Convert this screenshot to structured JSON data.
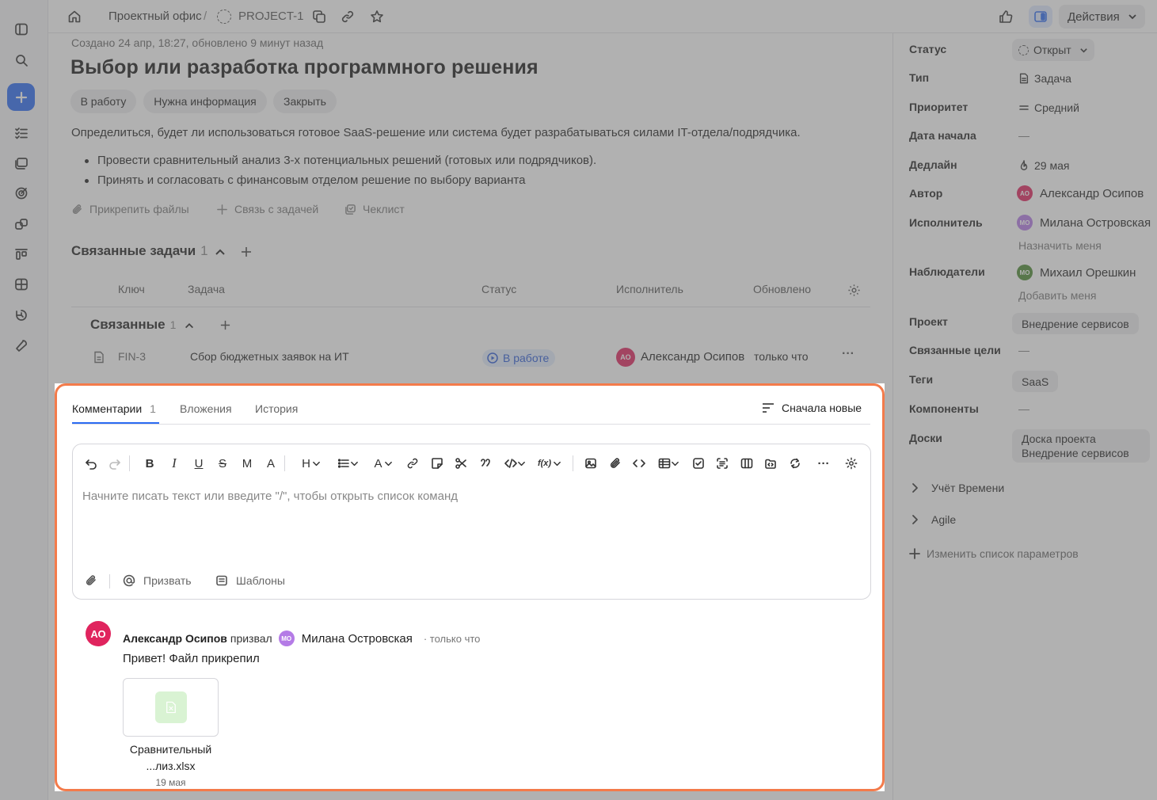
{
  "header": {
    "home_icon": "home-icon",
    "breadcrumb_1": "Проектный офис",
    "separator": "/",
    "breadcrumb_2": "PROJECT-1",
    "actions_label": "Действия"
  },
  "rail": {
    "items": [
      "panel-toggle-icon",
      "search-icon",
      "plus-icon",
      "tasks-icon",
      "stack-icon",
      "target-icon",
      "shapes-icon",
      "board-icon",
      "grid-icon",
      "history-icon",
      "wrench-icon"
    ]
  },
  "issue": {
    "meta": "Создано 24 апр, 18:27, обновлено 9 минут назад",
    "title": "Выбор или разработка программного решения",
    "actions": [
      "В работу",
      "Нужна информация",
      "Закрыть"
    ],
    "description": "Определиться, будет ли использоваться готовое SaaS-решение или система будет разрабатываться силами IT-отдела/подрядчика.",
    "bullets": [
      "Провести сравнительный анализ 3-х потенциальных решений (готовых или подрядчиков).",
      "Принять и согласовать с финансовым отделом решение по выбору варианта"
    ],
    "attach_files": "Прикрепить файлы",
    "link_task": "Связь с задачей",
    "checklist": "Чеклист"
  },
  "related": {
    "title": "Связанные задачи",
    "count": "1",
    "columns": [
      "Ключ",
      "Задача",
      "Статус",
      "Исполнитель",
      "Обновлено"
    ],
    "group_title": "Связанные",
    "group_count": "1",
    "row": {
      "key": "FIN-3",
      "task": "Сбор бюджетных заявок на ИТ",
      "status": "В работе",
      "assignee_initials": "АО",
      "assignee": "Александр Осипов",
      "updated": "только что",
      "more": "···"
    }
  },
  "comments": {
    "tabs": [
      "Комментарии",
      "Вложения",
      "История"
    ],
    "comments_count": "1",
    "sort_label": "Сначала новые",
    "placeholder": "Начните писать текст или введите \"/\", чтобы открыть список команд",
    "mention_label": "Призвать",
    "templates_label": "Шаблоны",
    "toolbar_text": {
      "bold": "B",
      "italic": "I",
      "underline": "U",
      "strike": "S",
      "mono": "M",
      "size": "A",
      "heading": "H",
      "color": "A",
      "formula": "f(x)",
      "more": "···"
    },
    "item": {
      "author_initials": "АО",
      "author": "Александр Осипов",
      "action": "призвал",
      "mention_initials": "МО",
      "mention": "Милана Островская",
      "time": "· только что",
      "text": "Привет! Файл прикрепил",
      "file_line1": "Сравнительный",
      "file_line2": "...лиз.xlsx",
      "file_date": "19 мая"
    }
  },
  "sidebar": {
    "status_label": "Статус",
    "status_value": "Открыт",
    "type_label": "Тип",
    "type_value": "Задача",
    "priority_label": "Приоритет",
    "priority_value": "Средний",
    "start_label": "Дата начала",
    "start_value": "—",
    "deadline_label": "Дедлайн",
    "deadline_value": "29 мая",
    "author_label": "Автор",
    "author_initials": "АО",
    "author_value": "Александр Осипов",
    "assignee_label": "Исполнитель",
    "assignee_initials": "МО",
    "assignee_value": "Милана Островская",
    "assign_me": "Назначить меня",
    "watchers_label": "Наблюдатели",
    "watcher_initials": "МО",
    "watcher_value": "Михаил Орешкин",
    "add_me": "Добавить меня",
    "project_label": "Проект",
    "project_value": "Внедрение сервисов",
    "goals_label": "Связанные цели",
    "goals_value": "—",
    "tags_label": "Теги",
    "tags_value": "SaaS",
    "components_label": "Компоненты",
    "components_value": "—",
    "boards_label": "Доски",
    "boards_value_1": "Доска проекта",
    "boards_value_2": "Внедрение сервисов",
    "time_tracking": "Учёт Времени",
    "agile": "Agile",
    "edit_params": "Изменить список параметров"
  },
  "colors": {
    "accent": "#2b6bf3",
    "highlight": "#f37b4b",
    "author_avatar": "#e0245e",
    "assignee_avatar": "#b47be6",
    "watcher_avatar": "#4d8a32"
  }
}
